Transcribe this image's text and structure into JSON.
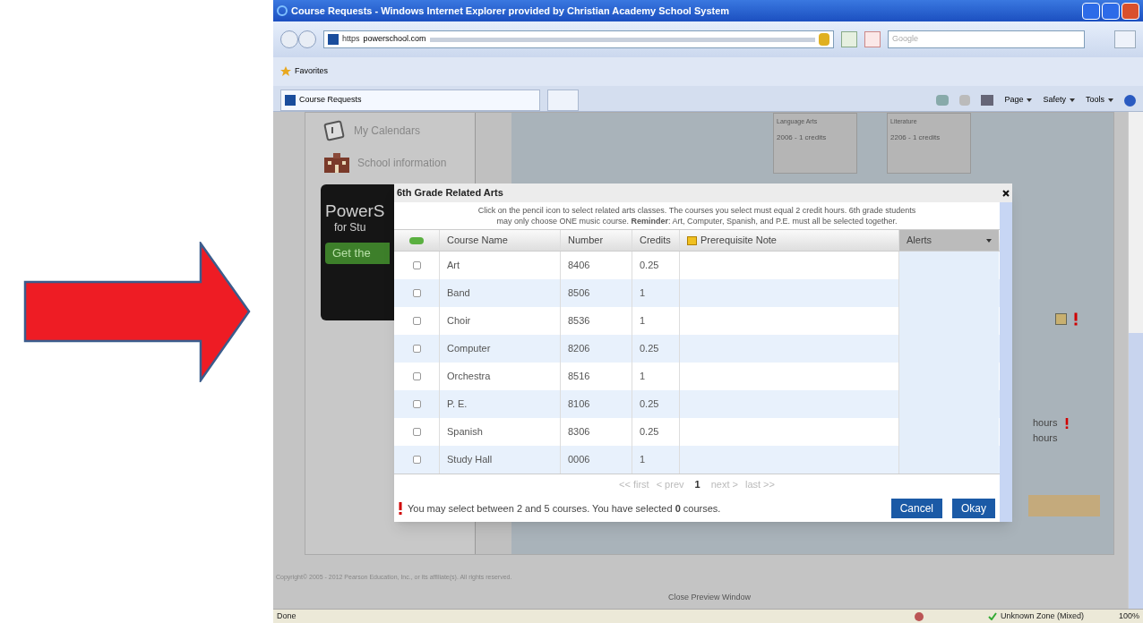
{
  "window": {
    "title": "Course Requests - Windows Internet Explorer provided by Christian Academy School System"
  },
  "address_bar": {
    "scheme": "https",
    "domain": "powerschool.com"
  },
  "search": {
    "placeholder": "Google"
  },
  "favorites_bar": {
    "label": "Favorites"
  },
  "tabs": [
    {
      "label": "Course Requests",
      "selected": true
    }
  ],
  "command_bar": [
    "Page",
    "Safety",
    "Tools"
  ],
  "sidebar": {
    "items": [
      {
        "label": "My Calendars",
        "kind": "calendar"
      },
      {
        "label": "School information",
        "kind": "building"
      }
    ]
  },
  "promo": {
    "line_1": "PowerS",
    "line_2": "for Stu",
    "button": "Get the"
  },
  "cards": [
    {
      "title": "Language Arts",
      "detail": "2006 - 1 credits"
    },
    {
      "title": "Literature",
      "detail": "2206 - 1 credits"
    }
  ],
  "side_notes": [
    {
      "text": "hours",
      "alert": true
    },
    {
      "text": "hours",
      "alert": false
    }
  ],
  "dialog": {
    "title": "6th Grade Related Arts",
    "instructions": "Click on the pencil icon to select related arts classes. The courses you select must equal 2 credit hours. 6th grade students may only choose ONE music course. **Reminder**: Art, Computer, Spanish, and P.E. must all be selected together.",
    "columns": [
      "Course Name",
      "Number",
      "Credits",
      "Prerequisite Note",
      "Alerts"
    ],
    "rows": [
      {
        "course": "Art",
        "number": "8406",
        "credits": "0.25",
        "checked": false
      },
      {
        "course": "Band",
        "number": "8506",
        "credits": "1",
        "checked": false
      },
      {
        "course": "Choir",
        "number": "8536",
        "credits": "1",
        "checked": false
      },
      {
        "course": "Computer",
        "number": "8206",
        "credits": "0.25",
        "checked": false
      },
      {
        "course": "Orchestra",
        "number": "8516",
        "credits": "1",
        "checked": false
      },
      {
        "course": "P. E.",
        "number": "8106",
        "credits": "0.25",
        "checked": false
      },
      {
        "course": "Spanish",
        "number": "8306",
        "credits": "0.25",
        "checked": false
      },
      {
        "course": "Study Hall",
        "number": "0006",
        "credits": "1",
        "checked": false
      }
    ],
    "pagination": {
      "first": "<< first",
      "prev": "< prev",
      "page": "1",
      "next": "next >",
      "last": "last >>"
    },
    "message": "You may select between 2 and 5 courses. You have selected **0** courses.",
    "buttons": [
      "Cancel",
      "Okay"
    ]
  },
  "footer": {
    "copyright": "Copyright© 2005 - 2012 Pearson Education, Inc., or its affiliate(s). All rights reserved.",
    "link": "Close Preview Window"
  },
  "status_bar": {
    "text": "Done",
    "zone": "Unknown Zone (Mixed)",
    "zoom": "100%"
  }
}
